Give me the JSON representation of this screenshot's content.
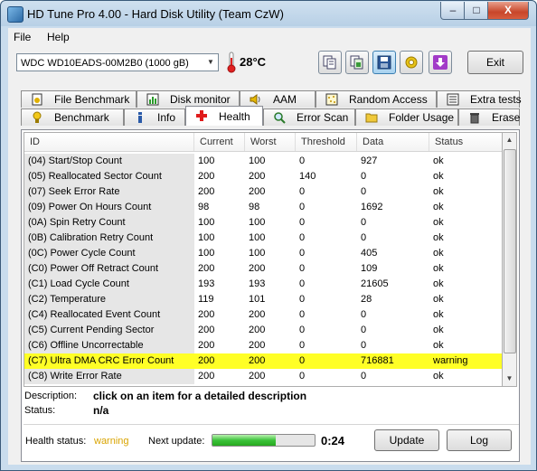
{
  "window": {
    "title": "HD Tune Pro 4.00 - Hard Disk Utility (Team CzW)"
  },
  "titlebar_buttons": {
    "minimize": "–",
    "maximize": "□",
    "close": "X"
  },
  "menu": [
    "File",
    "Help"
  ],
  "toolbar": {
    "drive": "WDC WD10EADS-00M2B0 (1000 gB)",
    "temperature": "28°C",
    "exit_label": "Exit"
  },
  "tabs_row1": [
    {
      "label": "File Benchmark",
      "icon": "file-benchmark-icon"
    },
    {
      "label": "Disk monitor",
      "icon": "disk-monitor-icon"
    },
    {
      "label": "AAM",
      "icon": "speaker-icon"
    },
    {
      "label": "Random Access",
      "icon": "random-access-icon"
    },
    {
      "label": "Extra tests",
      "icon": "extra-tests-icon"
    }
  ],
  "tabs_row2": [
    {
      "label": "Benchmark",
      "icon": "benchmark-icon"
    },
    {
      "label": "Info",
      "icon": "info-icon"
    },
    {
      "label": "Health",
      "icon": "health-cross-icon",
      "selected": true
    },
    {
      "label": "Error Scan",
      "icon": "magnifier-icon"
    },
    {
      "label": "Folder Usage",
      "icon": "folder-icon"
    },
    {
      "label": "Erase",
      "icon": "trash-icon"
    }
  ],
  "table": {
    "columns": [
      "ID",
      "Current",
      "Worst",
      "Threshold",
      "Data",
      "Status"
    ],
    "rows": [
      [
        "(04) Start/Stop Count",
        "100",
        "100",
        "0",
        "927",
        "ok"
      ],
      [
        "(05) Reallocated Sector Count",
        "200",
        "200",
        "140",
        "0",
        "ok"
      ],
      [
        "(07) Seek Error Rate",
        "200",
        "200",
        "0",
        "0",
        "ok"
      ],
      [
        "(09) Power On Hours Count",
        "98",
        "98",
        "0",
        "1692",
        "ok"
      ],
      [
        "(0A) Spin Retry Count",
        "100",
        "100",
        "0",
        "0",
        "ok"
      ],
      [
        "(0B) Calibration Retry Count",
        "100",
        "100",
        "0",
        "0",
        "ok"
      ],
      [
        "(0C) Power Cycle Count",
        "100",
        "100",
        "0",
        "405",
        "ok"
      ],
      [
        "(C0) Power Off Retract Count",
        "200",
        "200",
        "0",
        "109",
        "ok"
      ],
      [
        "(C1) Load Cycle Count",
        "193",
        "193",
        "0",
        "21605",
        "ok"
      ],
      [
        "(C2) Temperature",
        "119",
        "101",
        "0",
        "28",
        "ok"
      ],
      [
        "(C4) Reallocated Event Count",
        "200",
        "200",
        "0",
        "0",
        "ok"
      ],
      [
        "(C5) Current Pending Sector",
        "200",
        "200",
        "0",
        "0",
        "ok"
      ],
      [
        "(C6) Offline Uncorrectable",
        "200",
        "200",
        "0",
        "0",
        "ok"
      ],
      [
        "(C7) Ultra DMA CRC Error Count",
        "200",
        "200",
        "0",
        "716881",
        "warning"
      ],
      [
        "(C8) Write Error Rate",
        "200",
        "200",
        "0",
        "0",
        "ok"
      ]
    ],
    "highlight_color": "#ffff26"
  },
  "description": {
    "description_label": "Description:",
    "description_value": "click on an item for a detailed description",
    "status_label": "Status:",
    "status_value": "n/a"
  },
  "footer": {
    "health_label": "Health status:",
    "health_value": "warning",
    "next_label": "Next update:",
    "progress_fraction": 0.62,
    "time": "0:24",
    "update_label": "Update",
    "log_label": "Log"
  }
}
